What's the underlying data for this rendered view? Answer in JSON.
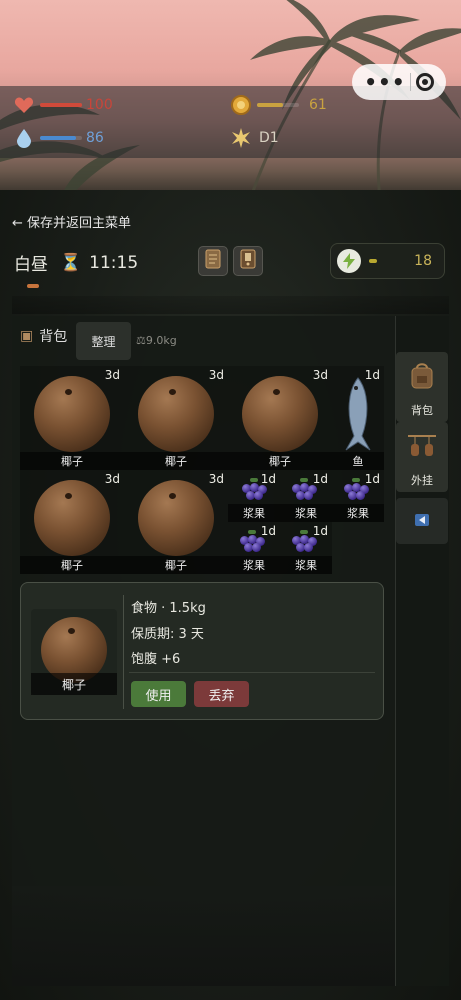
{
  "status": {
    "health": {
      "icon": "heart-icon",
      "value": "100",
      "fraction": 1.0,
      "color": "#d04a3a"
    },
    "water": {
      "icon": "water-drop-icon",
      "value": "86",
      "fraction": 0.86,
      "color": "#4a8ad0"
    },
    "food": {
      "icon": "food-coin-icon",
      "value": "61",
      "fraction": 0.61,
      "color": "#c9a240"
    },
    "day": {
      "icon": "sun-icon",
      "value": "D1"
    }
  },
  "capsule": {
    "more": "•••",
    "close": "record-icon"
  },
  "nav": {
    "back_label": "← 保存并返回主菜单"
  },
  "clock": {
    "phase": "白昼",
    "hourglass": "⏳",
    "time": "11:15"
  },
  "toolbar": {
    "craft_icon": "crafting-book-icon",
    "map_icon": "journal-icon"
  },
  "energy": {
    "icon": "lightning-icon",
    "value": "18"
  },
  "inventory": {
    "title": "背包",
    "sort_label": "整理",
    "weight": "9.0kg",
    "slots": [
      {
        "name": "椰子",
        "badge": "3d"
      },
      {
        "name": "椰子",
        "badge": "3d"
      },
      {
        "name": "椰子",
        "badge": "3d"
      },
      {
        "name": "鱼",
        "badge": "1d"
      },
      {
        "name": "浆果",
        "badge": "1d"
      },
      {
        "name": "浆果",
        "badge": "1d"
      },
      {
        "name": "浆果",
        "badge": "1d"
      },
      {
        "name": "椰子",
        "badge": "3d"
      },
      {
        "name": "椰子",
        "badge": "3d"
      },
      {
        "name": "浆果",
        "badge": "1d"
      },
      {
        "name": "浆果",
        "badge": "1d"
      }
    ]
  },
  "side_tabs": {
    "bag": "背包",
    "hang": "外挂",
    "collapse_icon": "collapse-left-icon"
  },
  "detail": {
    "item_name": "椰子",
    "type_weight": "食物 · 1.5kg",
    "shelf_life": "保质期: 3 天",
    "satiety": "饱腹 +6",
    "use_label": "使用",
    "drop_label": "丢弃"
  },
  "colors": {
    "accent_green": "#4b7a3a",
    "accent_red": "#7c3a3a",
    "energy_gold": "#c9b45a"
  }
}
